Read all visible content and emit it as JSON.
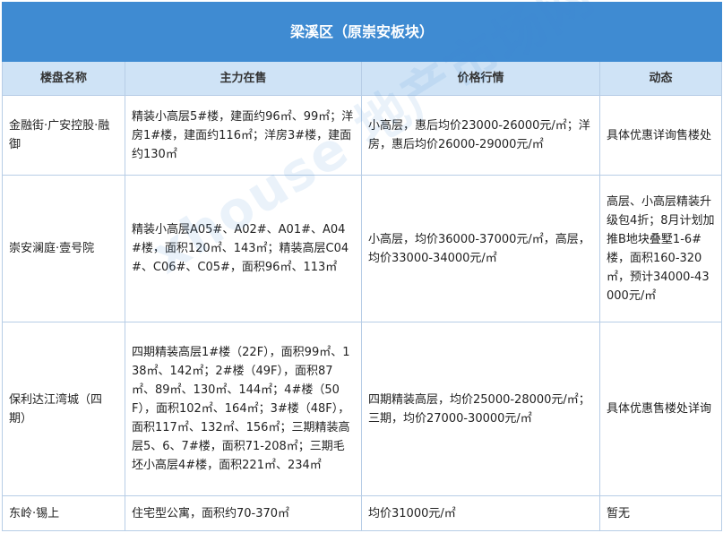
{
  "table": {
    "title": "梁溪区（原崇安板块）",
    "headers": [
      "楼盘名称",
      "主力在售",
      "价格行情",
      "动态"
    ],
    "rows": [
      {
        "name": "金融街·广安控股·融御",
        "offering": "精装小高层5#楼，建面约96㎡、99㎡；洋房1#楼，建面约116㎡；洋房3#楼，建面约130㎡",
        "price": "小高层，惠后均价23000-26000元/㎡；洋房，惠后均价26000-29000元/㎡",
        "news": "具体优惠详询售楼处"
      },
      {
        "name": "崇安澜庭·壹号院",
        "offering": "精装小高层A05#、A02#、A01#、A04#楼，面积120㎡、143㎡；精装高层C04#、C06#、C05#，面积96㎡、113㎡",
        "price": "小高层，均价36000-37000元/㎡，高层，均价33000-34000元/㎡",
        "news": "高层、小高层精装升级包4折；8月计划加推B地块叠墅1-6#楼，面积160-320㎡，预计34000-43000元/㎡"
      },
      {
        "name": "保利达江湾城（四期）",
        "offering": "四期精装高层1#楼（22F），面积99㎡、138㎡、142㎡；2#楼（49F），面积87㎡、89㎡、130㎡、144㎡；4#楼（50F），面积102㎡、164㎡；3#楼（48F），面积117㎡、132㎡、156㎡；三期精装高层5、6、7#楼，面积71-208㎡；三期毛坯小高层4#楼，面积221㎡、234㎡",
        "price": "四期精装高层，均价25000-28000元/㎡；三期，均价27000-30000元/㎡",
        "news": "具体优惠售楼处详询"
      },
      {
        "name": "东岭·锡上",
        "offering": "住宅型公寓，面积约70-370㎡",
        "price": "均价31000元/㎡",
        "news": "暂无"
      }
    ]
  },
  "colors": {
    "title_bg": "#3f8bd2",
    "header_bg": "#cfe3f6",
    "border": "#b7cde6"
  }
}
